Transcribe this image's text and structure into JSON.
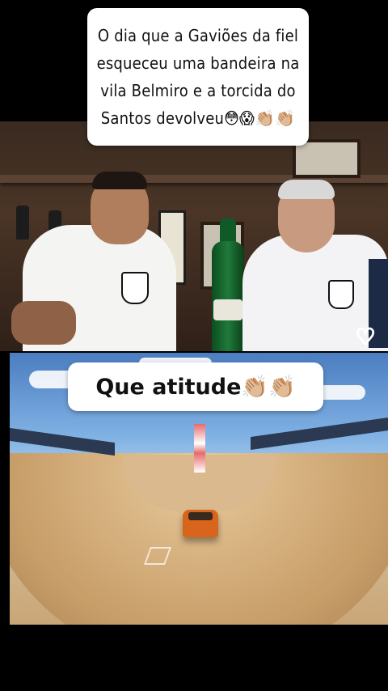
{
  "caption": {
    "lines": [
      "O dia que a Gaviões da fiel",
      "esqueceu uma bandeira na",
      "vila Belmiro  e a torcida do",
      "Santos devolveu😳😱👏🏼👏🏼"
    ]
  },
  "overlay": {
    "text": "Que atitude👏🏼👏🏼"
  },
  "icons": {
    "like": "heart-outline-icon"
  },
  "colors": {
    "background": "#000000",
    "card": "#ffffff",
    "text": "#111111"
  }
}
